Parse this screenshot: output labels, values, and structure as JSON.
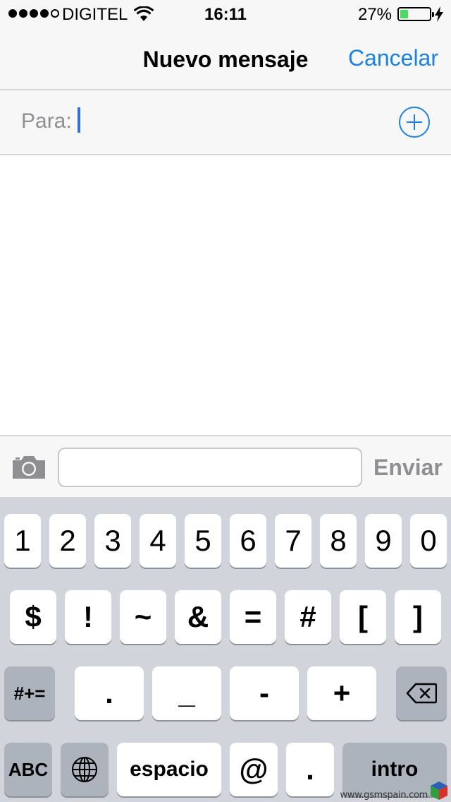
{
  "status_bar": {
    "carrier": "DIGITEL",
    "time": "16:11",
    "battery_percent": "27%",
    "battery_level": 0.27,
    "battery_fill_color": "#4cd964",
    "signal_bars": 4,
    "icons": [
      "signal-dots",
      "wifi-icon",
      "battery-icon",
      "charging-bolt-icon"
    ]
  },
  "nav": {
    "title": "Nuevo mensaje",
    "cancel_label": "Cancelar",
    "accent_color": "#1a82e2"
  },
  "recipient": {
    "label": "Para:",
    "value": "",
    "add_icon": "plus-circle-icon"
  },
  "compose": {
    "camera_icon": "camera-icon",
    "message_value": "",
    "message_placeholder": "",
    "send_label": "Enviar"
  },
  "keyboard": {
    "row1": [
      "1",
      "2",
      "3",
      "4",
      "5",
      "6",
      "7",
      "8",
      "9",
      "0"
    ],
    "row2": [
      "$",
      "!",
      "~",
      "&",
      "=",
      "#",
      "[",
      "]"
    ],
    "row3_mode_label": "#+=",
    "row3": [
      ".",
      "_",
      "-",
      "+"
    ],
    "backspace_icon": "backspace-icon",
    "mode_label": "ABC",
    "globe_icon": "globe-icon",
    "space_label": "espacio",
    "at_label": "@",
    "dot_label": ".",
    "return_label": "intro"
  },
  "watermark": {
    "text": "www.gsmspain.com"
  }
}
